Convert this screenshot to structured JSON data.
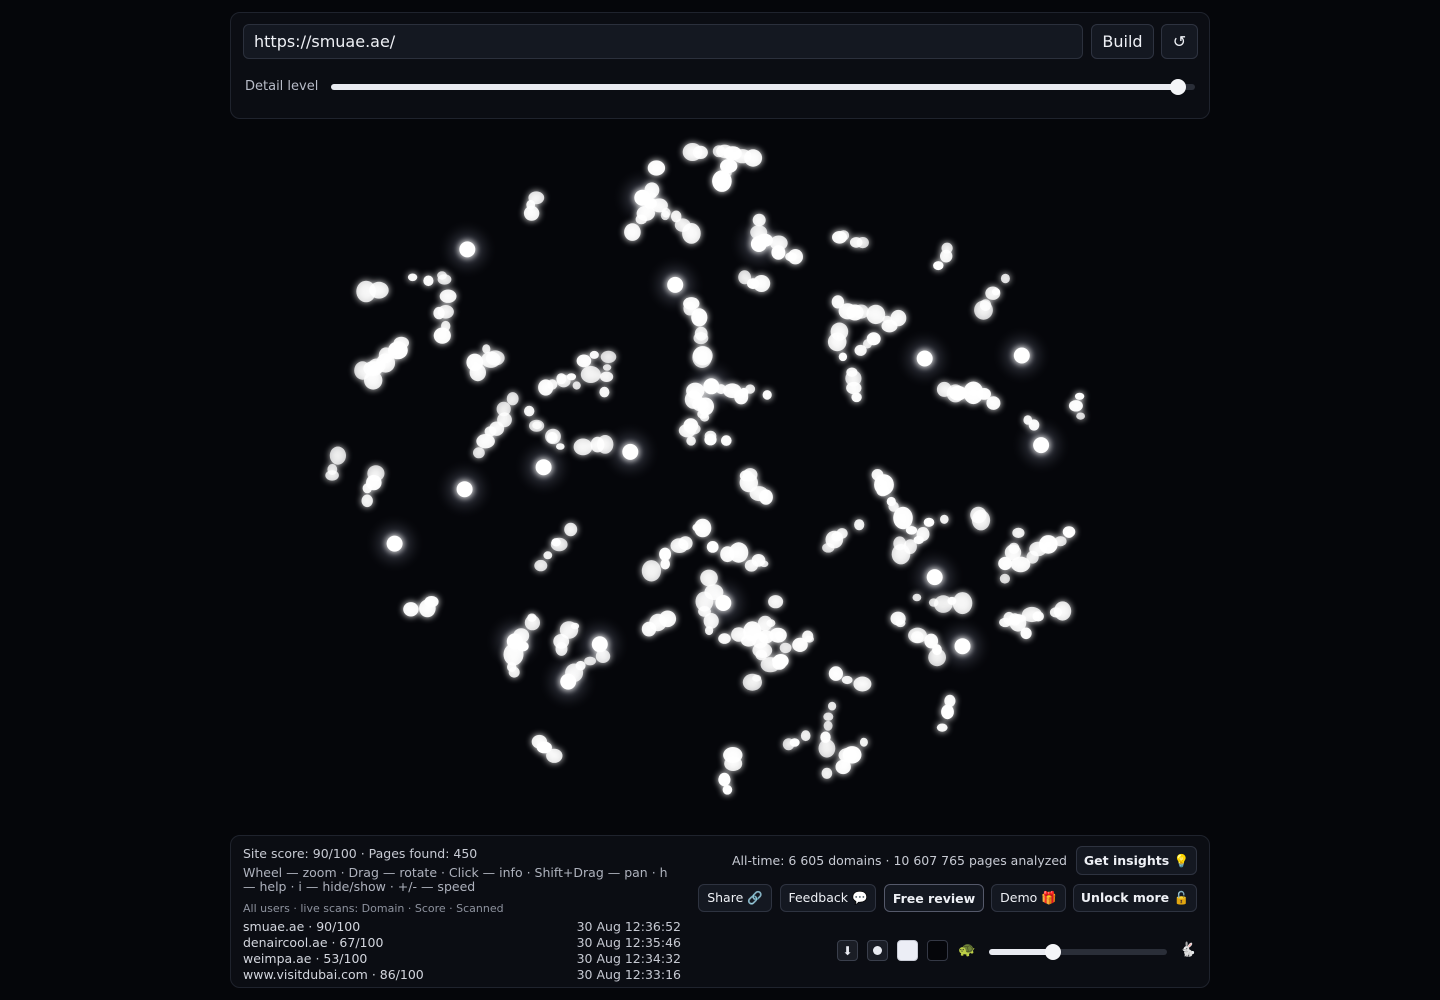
{
  "url_input": {
    "value": "https://smuae.ae/"
  },
  "toolbar": {
    "build_label": "Build",
    "reset_icon": "↺"
  },
  "detail": {
    "label": "Detail level",
    "value_fraction": 0.98
  },
  "stats": {
    "site_score": "Site score: 90/100 · Pages found: 450",
    "help": "Wheel — zoom · Drag — rotate · Click — info · Shift+Drag — pan · h — help · i — hide/show · +/- — speed",
    "live_header": "All users · live scans: Domain · Score · Scanned",
    "alltime": "All-time: 6 605 domains · 10 607 765 pages analyzed"
  },
  "scans": [
    {
      "domain": "smuae.ae · 90/100",
      "time": "30 Aug 12:36:52"
    },
    {
      "domain": "denaircool.ae · 67/100",
      "time": "30 Aug 12:35:46"
    },
    {
      "domain": "weimpa.ae · 53/100",
      "time": "30 Aug 12:34:32"
    },
    {
      "domain": "www.visitdubai.com · 86/100",
      "time": "30 Aug 12:33:16"
    }
  ],
  "actions": {
    "insights": "Get insights 💡",
    "share": "Share 🔗",
    "feedback": "Feedback 💬",
    "free_review": "Free review",
    "demo": "Demo 🎁",
    "unlock": "Unlock more 🔓"
  },
  "controls": {
    "download_icon": "⬇",
    "turtle_icon": "🐢",
    "rabbit_icon": "🐇",
    "speed_fraction": 0.36
  },
  "colors": {
    "background": "#05060a",
    "node": "#ffffff"
  }
}
